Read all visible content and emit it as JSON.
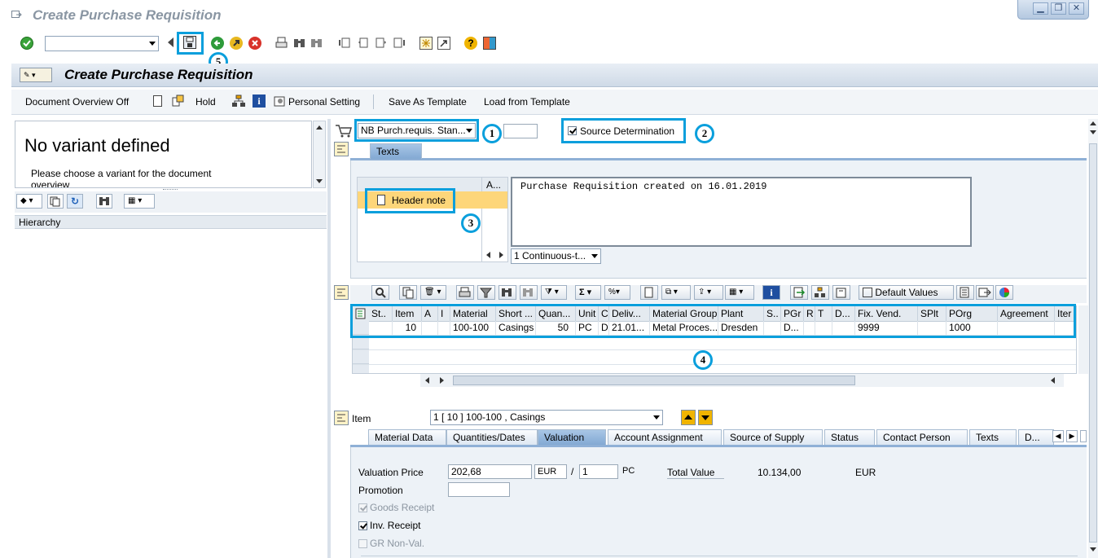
{
  "window": {
    "title": "Create Purchase Requisition",
    "controls": [
      "minimize-icon",
      "restore-icon",
      "close-icon"
    ]
  },
  "toolbar": {
    "command_field": ""
  },
  "screen": {
    "title": "Create Purchase Requisition"
  },
  "app_toolbar": {
    "doc_overview": "Document Overview Off",
    "hold": "Hold",
    "personal_setting": "Personal Setting",
    "save_template": "Save As Template",
    "load_template": "Load from Template"
  },
  "left_panel": {
    "heading": "No variant defined",
    "text": "Please choose a variant for the document overview",
    "hierarchy_header": "Hierarchy"
  },
  "header": {
    "doc_type": "NB Purch.requis. Stan...",
    "doc_number": "",
    "source_determination": "Source Determination",
    "source_determination_checked": true,
    "texts_tab": "Texts",
    "text_list_header": "A...",
    "header_note": "Header note",
    "note_text": "Purchase Requisition created on 16.01.2019",
    "text_format": "1 Continuous-t..."
  },
  "items_toolbar": {
    "default_values": "Default Values"
  },
  "items_grid": {
    "columns": [
      "St..",
      "Item",
      "A",
      "I",
      "Material",
      "Short ...",
      "Quan...",
      "Unit",
      "C",
      "Deliv...",
      "Material Group",
      "Plant",
      "S..",
      "PGr",
      "R",
      "T",
      "D...",
      "Fix. Vend.",
      "SPlt",
      "POrg",
      "Agreement",
      "Iter"
    ],
    "rows": [
      [
        "",
        "10",
        "",
        "",
        "100-100",
        "Casings",
        "50",
        "PC",
        "D",
        "21.01...",
        "Metal Proces...",
        "Dresden",
        "",
        "D...",
        "",
        "",
        "",
        "9999",
        "",
        "1000",
        "",
        ""
      ]
    ]
  },
  "item_detail": {
    "label": "Item",
    "selector": "1 [ 10 ] 100-100 , Casings",
    "tabs": [
      "Material Data",
      "Quantities/Dates",
      "Valuation",
      "Account Assignment",
      "Source of Supply",
      "Status",
      "Contact Person",
      "Texts",
      "D..."
    ],
    "active_tab": "Valuation",
    "valuation_price_label": "Valuation Price",
    "valuation_price": "202,68",
    "currency": "EUR",
    "per": "/",
    "price_unit": "1",
    "unit": "PC",
    "total_value_label": "Total Value",
    "total_value": "10.134,00",
    "total_currency": "EUR",
    "promotion_label": "Promotion",
    "promotion": "",
    "goods_receipt": "Goods Receipt",
    "goods_receipt_checked": true,
    "inv_receipt": "Inv. Receipt",
    "inv_receipt_checked": true,
    "gr_non_val": "GR Non-Val.",
    "gr_non_val_checked": false
  },
  "annotations": [
    "1",
    "2",
    "3",
    "4",
    "5"
  ],
  "colors": {
    "highlight": "#0a9fdc",
    "tab_active": "#93b6dd",
    "title_bar": "#ffffff",
    "header_note_bg": "#fdd67a"
  }
}
